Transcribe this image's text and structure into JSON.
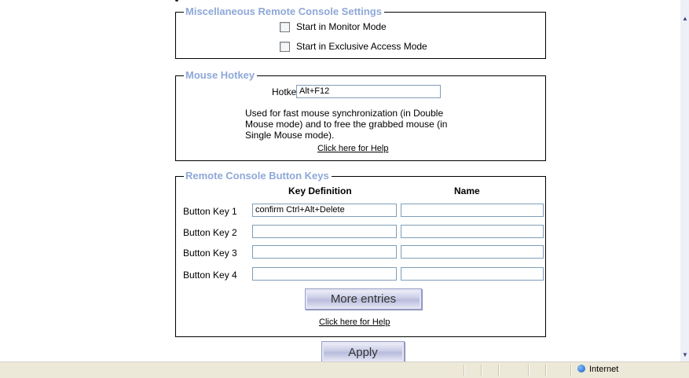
{
  "misc": {
    "legend": "Miscellaneous Remote Console Settings",
    "monitor_mode_label": "Start in Monitor Mode",
    "exclusive_mode_label": "Start in Exclusive Access Mode"
  },
  "mouse_hotkey": {
    "legend": "Mouse Hotkey",
    "hotkey_label": "Hotkey",
    "hotkey_value": "Alt+F12",
    "desc_line1": "Used for fast mouse synchronization (in Double",
    "desc_line2": "Mouse mode) and to free the grabbed mouse (in",
    "desc_line3": "Single Mouse mode).",
    "help_link": "Click here for Help"
  },
  "button_keys": {
    "legend": "Remote Console Button Keys",
    "col_key_definition": "Key Definition",
    "col_name": "Name",
    "rows": [
      {
        "label": "Button Key 1",
        "definition": "confirm Ctrl+Alt+Delete",
        "name": ""
      },
      {
        "label": "Button Key 2",
        "definition": "",
        "name": ""
      },
      {
        "label": "Button Key 3",
        "definition": "",
        "name": ""
      },
      {
        "label": "Button Key 4",
        "definition": "",
        "name": ""
      }
    ],
    "more_entries_label": "More entries",
    "help_link": "Click here for Help"
  },
  "apply_label": "Apply",
  "status_bar": {
    "zone_label": "Internet"
  }
}
